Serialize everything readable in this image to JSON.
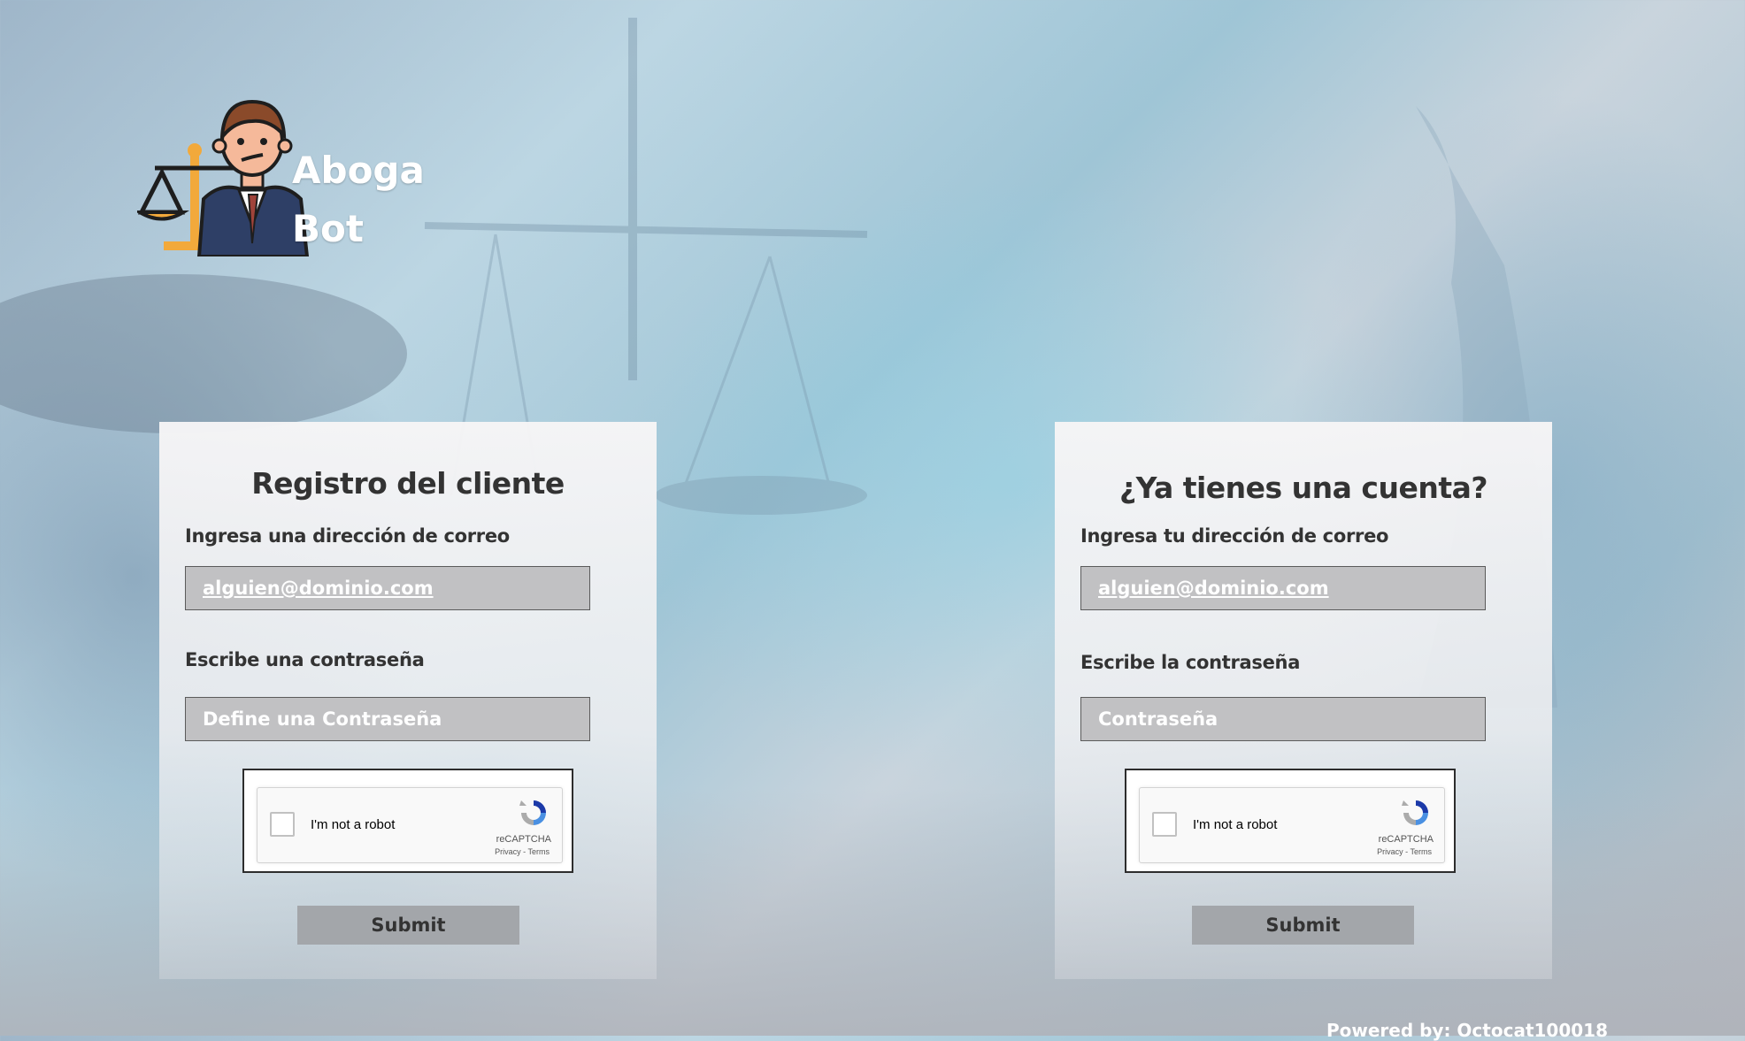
{
  "brand": {
    "line1": "Aboga",
    "line2": "Bot",
    "logo_icon": "lawyer-with-scales-icon"
  },
  "register": {
    "title": "Registro del cliente",
    "email_label": "Ingresa una dirección de correo",
    "email_value": "alguien@dominio.com",
    "password_label": "Escribe una contraseña",
    "password_placeholder": "Define una Contraseña",
    "captcha_text": "I'm not a robot",
    "captcha_brand": "reCAPTCHA",
    "captcha_links": "Privacy - Terms",
    "submit_label": "Submit"
  },
  "login": {
    "title": "¿Ya tienes una cuenta?",
    "email_label": "Ingresa tu dirección de correo",
    "email_value": "alguien@dominio.com",
    "password_label": "Escribe la contraseña",
    "password_placeholder": "Contraseña",
    "captcha_text": "I'm not a robot",
    "captcha_brand": "reCAPTCHA",
    "captcha_links": "Privacy - Terms",
    "submit_label": "Submit"
  },
  "footer": {
    "text": "Powered by: Octocat100018"
  },
  "colors": {
    "field_bg": "#c1c1c3",
    "button_bg": "#a3a6aa",
    "text_dark": "#333333"
  }
}
